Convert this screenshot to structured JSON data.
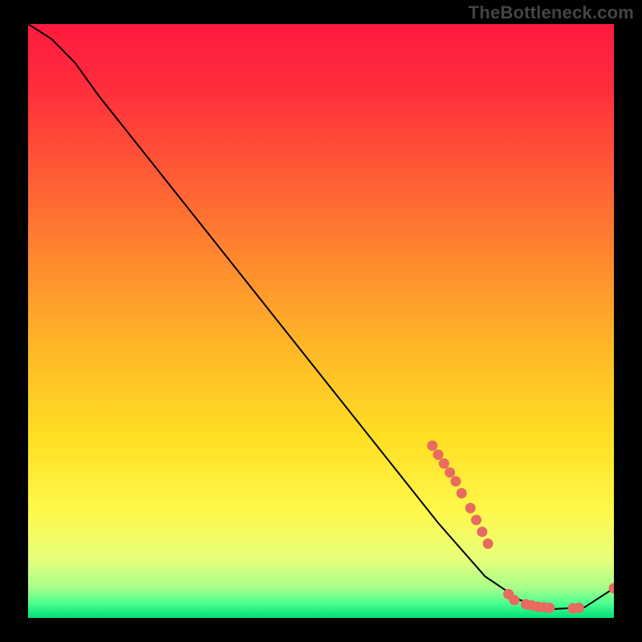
{
  "watermark": "TheBottleneck.com",
  "chart_data": {
    "type": "line",
    "title": "",
    "xlabel": "",
    "ylabel": "",
    "xlim": [
      0,
      100
    ],
    "ylim": [
      0,
      100
    ],
    "curve": [
      {
        "x": 0,
        "y": 100
      },
      {
        "x": 4,
        "y": 97.5
      },
      {
        "x": 8,
        "y": 93.5
      },
      {
        "x": 12,
        "y": 88
      },
      {
        "x": 70,
        "y": 16
      },
      {
        "x": 78,
        "y": 7
      },
      {
        "x": 84,
        "y": 3
      },
      {
        "x": 90,
        "y": 1.5
      },
      {
        "x": 95,
        "y": 1.8
      },
      {
        "x": 100,
        "y": 5
      }
    ],
    "markers": [
      {
        "x": 69,
        "y": 29
      },
      {
        "x": 70,
        "y": 27.5
      },
      {
        "x": 71,
        "y": 26
      },
      {
        "x": 72,
        "y": 24.5
      },
      {
        "x": 73,
        "y": 23
      },
      {
        "x": 74,
        "y": 21
      },
      {
        "x": 75.5,
        "y": 18.5
      },
      {
        "x": 76.5,
        "y": 16.5
      },
      {
        "x": 77.5,
        "y": 14.5
      },
      {
        "x": 78.5,
        "y": 12.5
      },
      {
        "x": 82,
        "y": 4
      },
      {
        "x": 83,
        "y": 3
      },
      {
        "x": 85,
        "y": 2.3
      },
      {
        "x": 86,
        "y": 2.1
      },
      {
        "x": 87,
        "y": 1.9
      },
      {
        "x": 88,
        "y": 1.8
      },
      {
        "x": 89,
        "y": 1.7
      },
      {
        "x": 93,
        "y": 1.6
      },
      {
        "x": 94,
        "y": 1.7
      },
      {
        "x": 100,
        "y": 5
      }
    ],
    "gradient_stops": [
      {
        "offset": 0.0,
        "color": "#ff1a3f"
      },
      {
        "offset": 0.1,
        "color": "#ff2b3c"
      },
      {
        "offset": 0.25,
        "color": "#ff5a36"
      },
      {
        "offset": 0.4,
        "color": "#ff8a2e"
      },
      {
        "offset": 0.55,
        "color": "#ffb927"
      },
      {
        "offset": 0.7,
        "color": "#ffe024"
      },
      {
        "offset": 0.82,
        "color": "#fff84a"
      },
      {
        "offset": 0.9,
        "color": "#e8ff7a"
      },
      {
        "offset": 0.95,
        "color": "#a6ff8a"
      },
      {
        "offset": 0.975,
        "color": "#4dff8f"
      },
      {
        "offset": 1.0,
        "color": "#00e07a"
      }
    ],
    "marker_color": "#e96a5f",
    "line_color": "#000000"
  }
}
